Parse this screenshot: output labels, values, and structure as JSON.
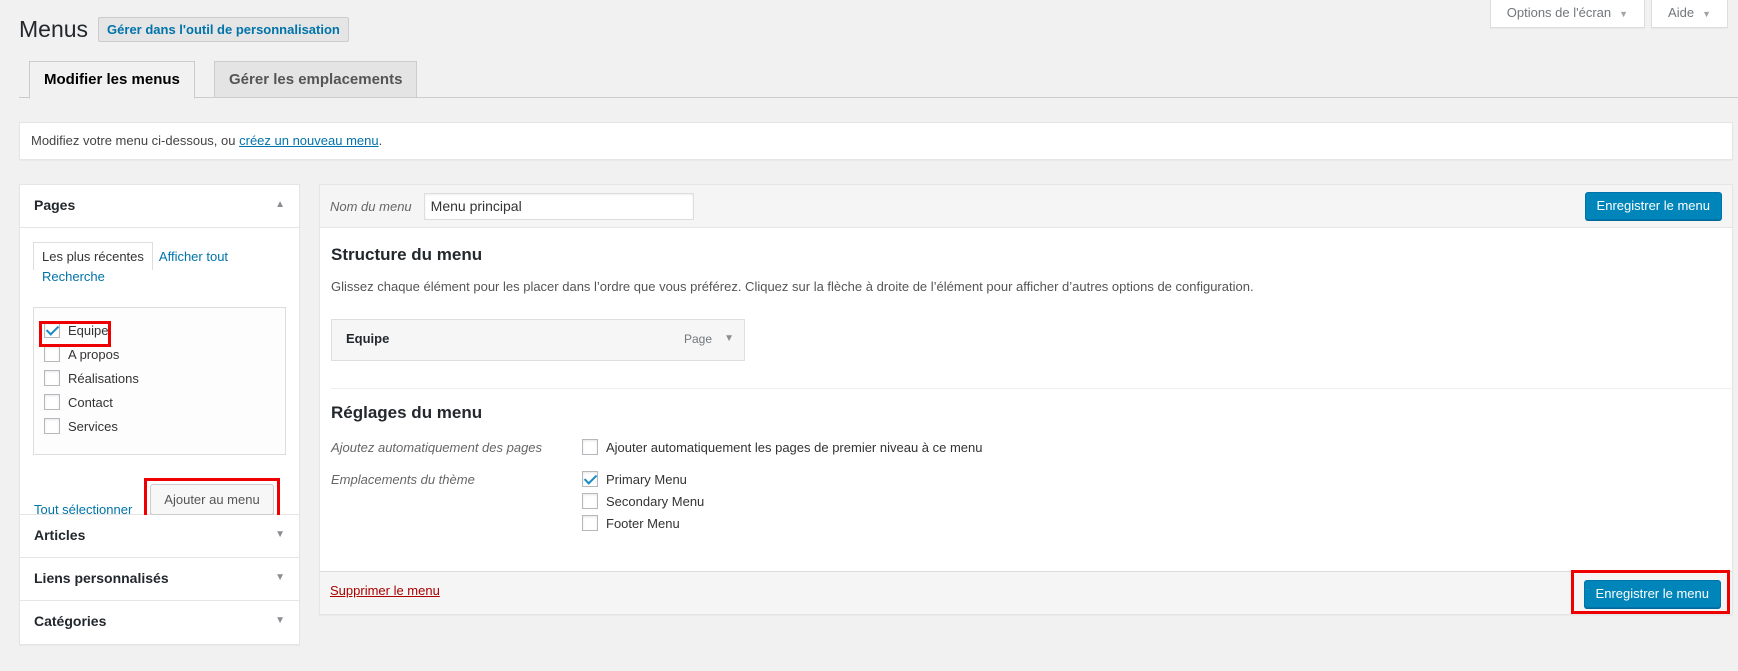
{
  "screen_meta": {
    "options_label": "Options de l'écran",
    "help_label": "Aide",
    "caret": "▼"
  },
  "header": {
    "title": "Menus",
    "action_label": "Gérer dans l'outil de personnalisation"
  },
  "tabs": [
    {
      "label": "Modifier les menus",
      "active": true
    },
    {
      "label": "Gérer les emplacements",
      "active": false
    }
  ],
  "notice": {
    "text_before": "Modifiez votre menu ci-dessous, ou ",
    "link": "créez un nouveau menu",
    "text_after": "."
  },
  "sidebar": {
    "pages": {
      "title": "Pages",
      "tab_recent": "Les plus récentes",
      "tab_all": "Afficher tout",
      "tab_search": "Recherche",
      "items": [
        {
          "label": "Equipe",
          "checked": true
        },
        {
          "label": "A propos",
          "checked": false
        },
        {
          "label": "Réalisations",
          "checked": false
        },
        {
          "label": "Contact",
          "checked": false
        },
        {
          "label": "Services",
          "checked": false
        }
      ],
      "select_all": "Tout sélectionner",
      "add_button": "Ajouter au menu"
    },
    "sections": [
      {
        "title": "Articles"
      },
      {
        "title": "Liens personnalisés"
      },
      {
        "title": "Catégories"
      }
    ]
  },
  "menu": {
    "name_label": "Nom du menu",
    "name_value": "Menu principal",
    "save_label": "Enregistrer le menu",
    "structure_title": "Structure du menu",
    "structure_desc": "Glissez chaque élément pour les placer dans l’ordre que vous préférez. Cliquez sur la flèche à droite de l’élément pour afficher d’autres options de configuration.",
    "items": [
      {
        "title": "Equipe",
        "type": "Page"
      }
    ],
    "settings_title": "Réglages du menu",
    "auto_add_label": "Ajoutez automatiquement des pages",
    "auto_add_option": "Ajouter automatiquement les pages de premier niveau à ce menu",
    "locations_label": "Emplacements du thème",
    "locations": [
      {
        "label": "Primary Menu",
        "checked": true
      },
      {
        "label": "Secondary Menu",
        "checked": false
      },
      {
        "label": "Footer Menu",
        "checked": false
      }
    ],
    "delete_label": "Supprimer le menu"
  },
  "colors": {
    "accent": "#0085ba",
    "highlight": "#e00000",
    "link": "#0073aa",
    "delete": "#aa0000"
  }
}
